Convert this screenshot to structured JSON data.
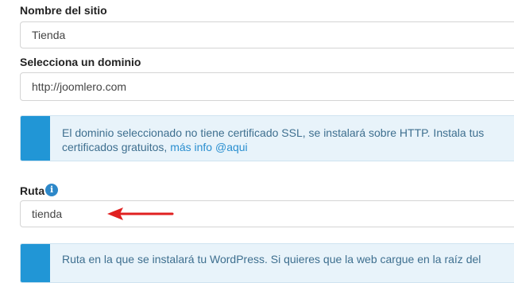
{
  "site_name": {
    "label": "Nombre del sitio",
    "value": "Tienda"
  },
  "domain": {
    "label": "Selecciona un dominio",
    "value": "http://joomlero.com"
  },
  "ssl_notice": {
    "text": "El dominio seleccionado no tiene certificado SSL, se instalará sobre HTTP. Instala tus certificados gratuitos,",
    "link": "más info @aqui"
  },
  "path": {
    "label": "Ruta",
    "value": "tienda",
    "info_icon": "info-icon"
  },
  "path_notice": {
    "text": "Ruta en la que se instalará tu WordPress. Si quieres que la web cargue en la raíz del"
  },
  "colors": {
    "accent": "#2196d6",
    "alert_bg": "#e8f3fa",
    "arrow": "#e02020"
  }
}
